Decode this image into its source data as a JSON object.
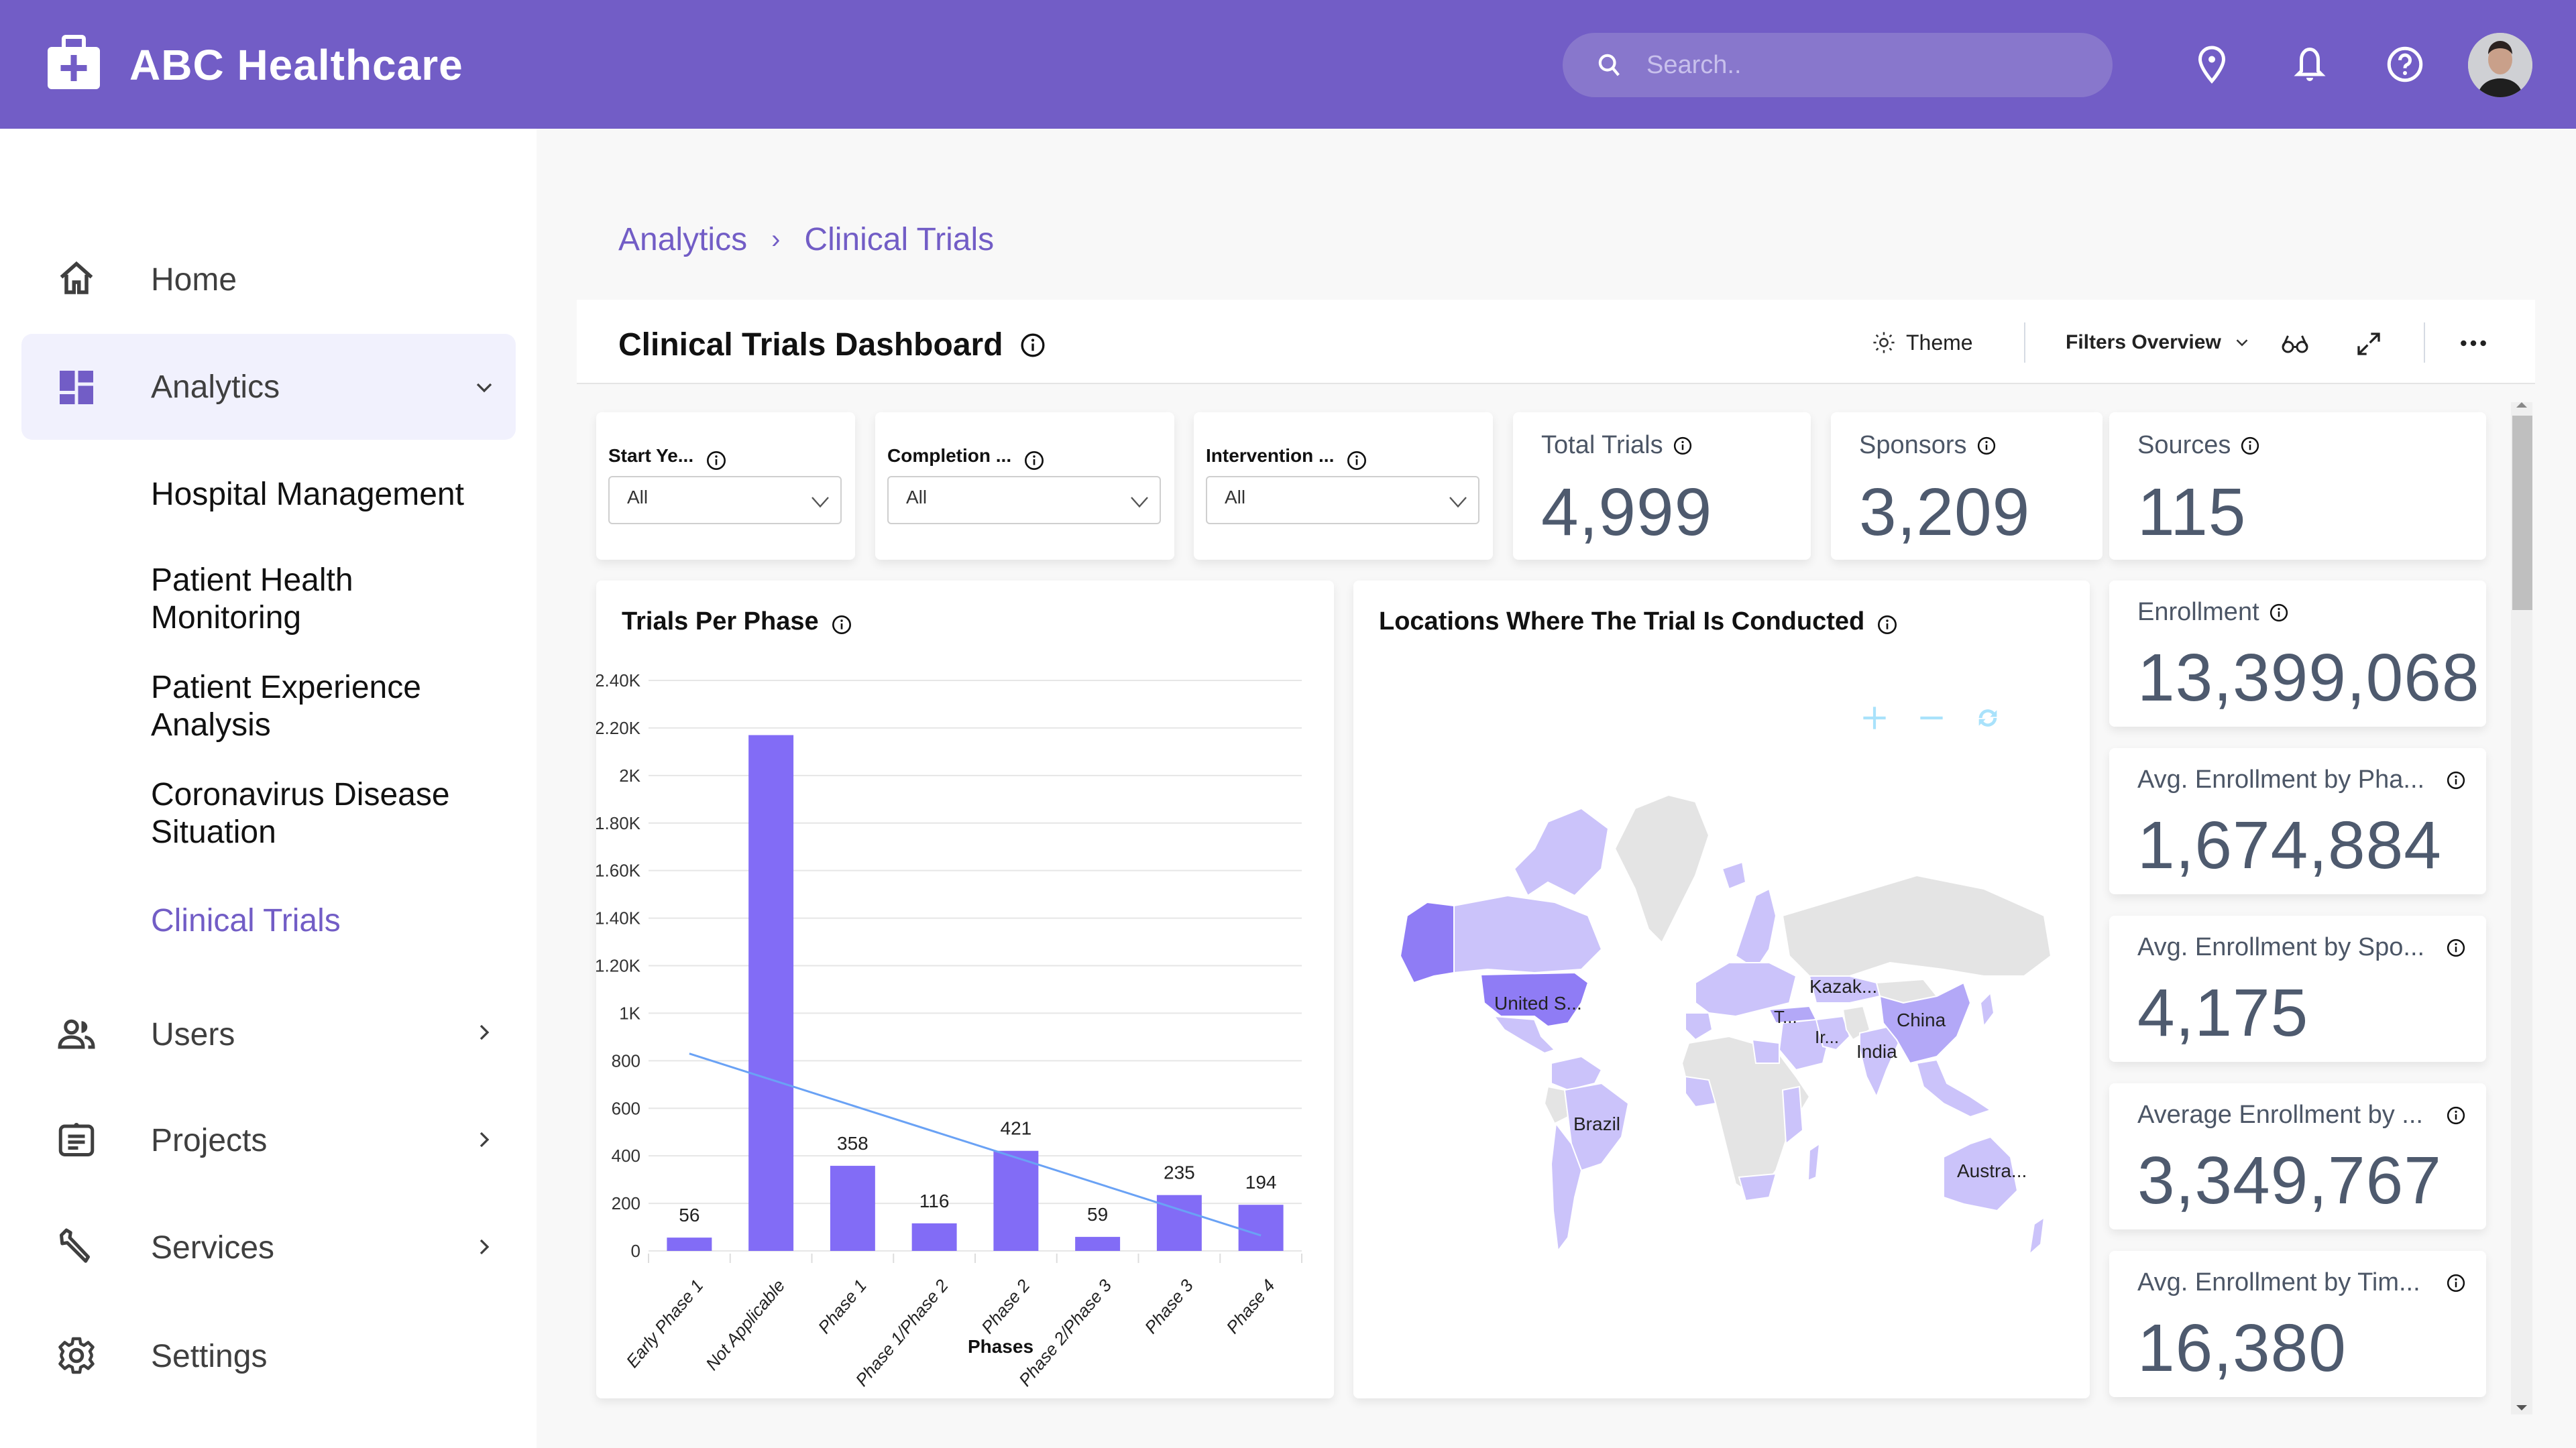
{
  "app": {
    "title": "ABC Healthcare",
    "brand_color": "#725dc6",
    "search_placeholder": "Search.."
  },
  "topbar": {
    "icons": [
      "location-icon",
      "bell-icon",
      "help-icon"
    ],
    "avatar_alt": "User avatar"
  },
  "sidebar": {
    "items": [
      {
        "label": "Home",
        "icon": "home-icon"
      },
      {
        "label": "Analytics",
        "icon": "dashboard-icon",
        "expanded": true,
        "active": true
      },
      {
        "label": "Users",
        "icon": "users-icon"
      },
      {
        "label": "Projects",
        "icon": "clipboard-icon"
      },
      {
        "label": "Services",
        "icon": "wrench-icon"
      },
      {
        "label": "Settings",
        "icon": "gear-icon"
      }
    ],
    "analytics_subitems": [
      {
        "label": "Hospital Management"
      },
      {
        "label": "Patient Health Monitoring"
      },
      {
        "label": "Patient Experience Analysis"
      },
      {
        "label": "Coronavirus Disease Situation"
      },
      {
        "label": "Clinical Trials",
        "active": true
      }
    ]
  },
  "breadcrumb": {
    "items": [
      "Analytics",
      "Clinical Trials"
    ],
    "separator": "›"
  },
  "dashboard": {
    "title": "Clinical Trials Dashboard",
    "toolbar": {
      "theme_label": "Theme",
      "filters_label": "Filters Overview"
    },
    "filters": [
      {
        "label": "Start Ye...",
        "value": "All"
      },
      {
        "label": "Completion ...",
        "value": "All"
      },
      {
        "label": "Intervention ...",
        "value": "All"
      }
    ],
    "kpis_top": [
      {
        "label": "Total Trials",
        "value": "4,999"
      },
      {
        "label": "Sponsors",
        "value": "3,209"
      },
      {
        "label": "Sources",
        "value": "115"
      }
    ],
    "kpis_side": [
      {
        "label": "Enrollment",
        "value": "13,399,068"
      },
      {
        "label": "Avg. Enrollment by Pha...",
        "value": "1,674,884"
      },
      {
        "label": "Avg. Enrollment by Spo...",
        "value": "4,175"
      },
      {
        "label": "Average Enrollment by ...",
        "value": "3,349,767"
      },
      {
        "label": "Avg. Enrollment by Tim...",
        "value": "16,380"
      }
    ],
    "map": {
      "title": "Locations Where The Trial Is Conducted",
      "controls": [
        "zoom-in",
        "zoom-out",
        "reset"
      ],
      "labels": [
        "United S...",
        "Kazak...",
        "China",
        "T...",
        "Ir...",
        "India",
        "Brazil",
        "Austra..."
      ],
      "colors": {
        "high": "#8f7cf5",
        "mid": "#b3a8f7",
        "low": "#cbc3fa",
        "none": "#e4e4e4"
      }
    }
  },
  "chart_data": {
    "type": "bar",
    "title": "Trials Per Phase",
    "xlabel": "Phases",
    "ylabel": "",
    "categories": [
      "Early Phase 1",
      "Not Applicable",
      "Phase 1",
      "Phase 1/Phase 2",
      "Phase 2",
      "Phase 2/Phase 3",
      "Phase 3",
      "Phase 4"
    ],
    "values": [
      56,
      2170,
      358,
      116,
      421,
      59,
      235,
      194
    ],
    "data_labels": [
      "56",
      "",
      "358",
      "116",
      "421",
      "59",
      "235",
      "194"
    ],
    "ylim": [
      0,
      2400
    ],
    "yticks": [
      0,
      200,
      400,
      600,
      800,
      1000,
      1200,
      1400,
      1600,
      1800,
      2000,
      2200,
      2400
    ],
    "ytick_labels": [
      "0",
      "200",
      "400",
      "600",
      "800",
      "1K",
      "1.20K",
      "1.40K",
      "1.60K",
      "1.80K",
      "2K",
      "2.20K",
      "2.40K"
    ],
    "grid": true,
    "bar_color": "#826cf6",
    "trendline": {
      "type": "linear",
      "start": 830,
      "end": 65,
      "color": "#6aa2f5"
    }
  }
}
